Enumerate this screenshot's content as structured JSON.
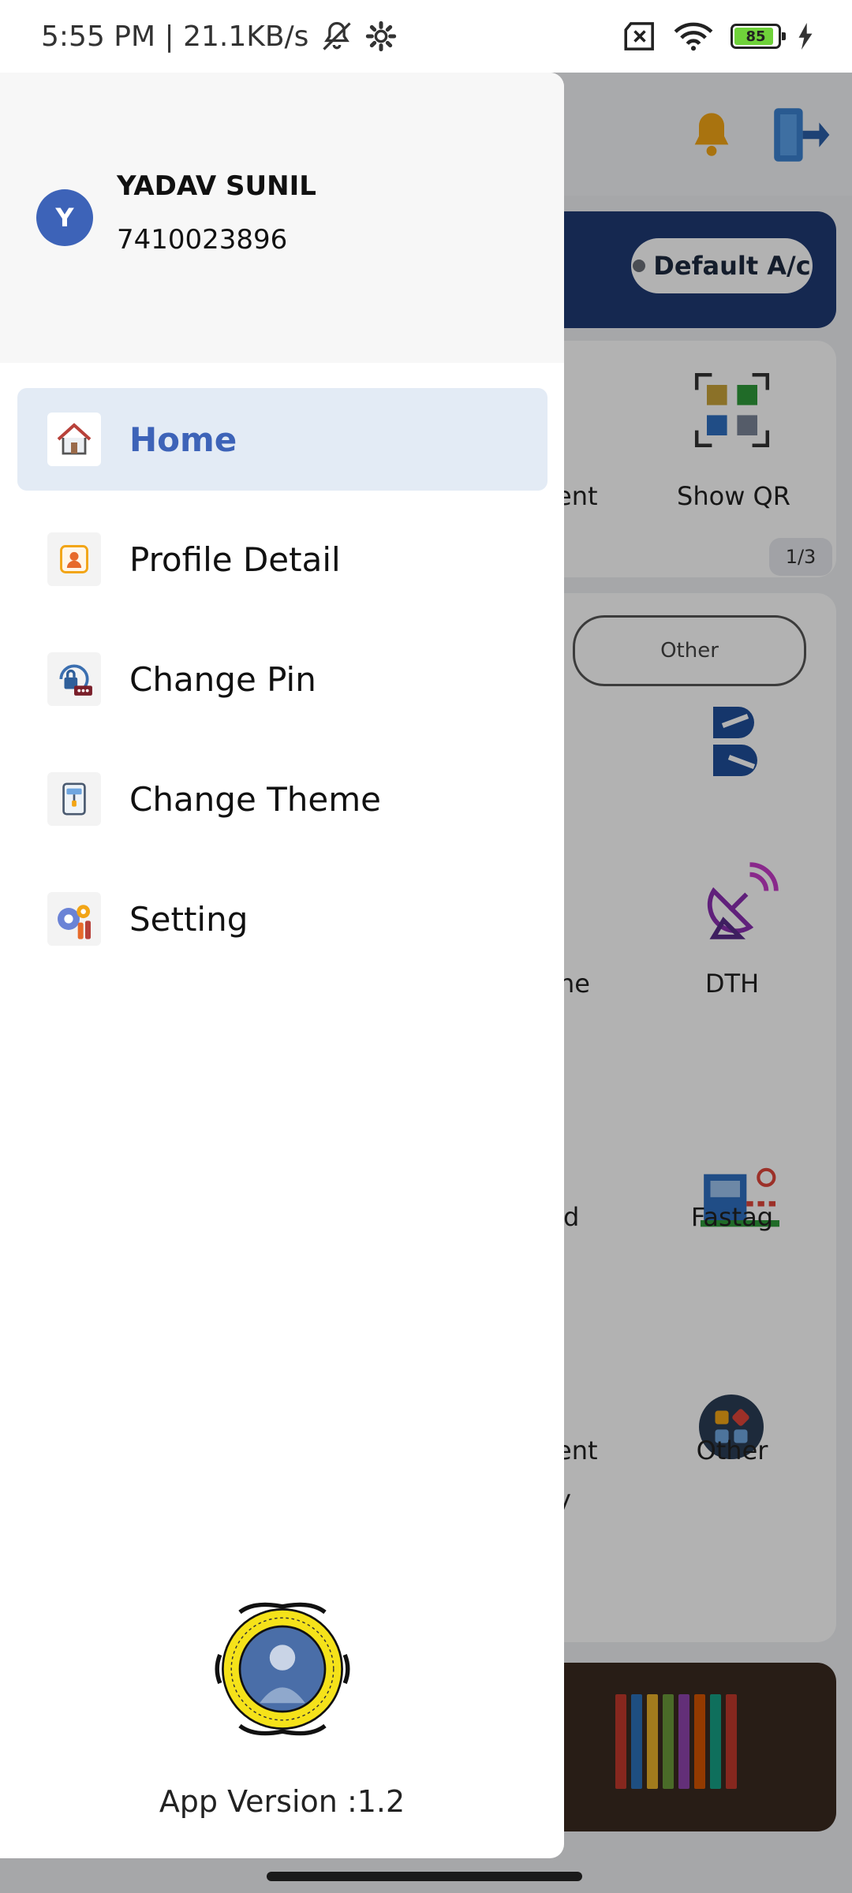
{
  "status_bar": {
    "time_speed": "5:55 PM | 21.1KB/s",
    "battery": "85"
  },
  "background": {
    "account_pill": "Default A/c",
    "show_qr": "Show QR",
    "pager": "1/3",
    "other_tab": "Other",
    "partial_left_1": "ent",
    "partial_left_2": "ne",
    "partial_left_3": "d",
    "partial_left_4": "ent",
    "partial_left_5": "y",
    "dth": "DTH",
    "fastag": "Fastag",
    "other": "Other"
  },
  "drawer": {
    "user": {
      "initial": "Y",
      "name": "YADAV SUNIL",
      "phone": "7410023896"
    },
    "menu": [
      {
        "label": "Home",
        "icon": "home-icon",
        "active": true
      },
      {
        "label": "Profile Detail",
        "icon": "profile-icon",
        "active": false
      },
      {
        "label": "Change Pin",
        "icon": "lock-icon",
        "active": false
      },
      {
        "label": "Change Theme",
        "icon": "theme-icon",
        "active": false
      },
      {
        "label": "Setting",
        "icon": "settings-icon",
        "active": false
      }
    ],
    "app_version": "App Version :1.2"
  },
  "colors": {
    "accent": "#3d63b8",
    "active_bg": "#e3ebf5",
    "header_bg": "#f7f7f7",
    "account_card": "#1f3a73"
  }
}
